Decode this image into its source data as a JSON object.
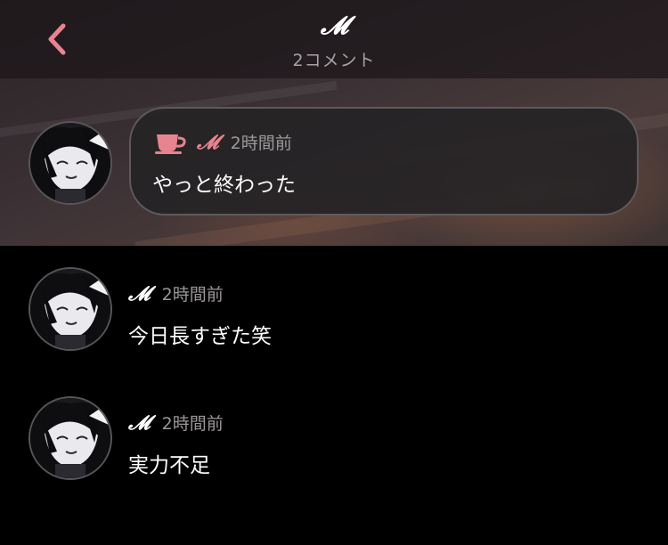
{
  "header": {
    "title": "𝓜",
    "subtitle": "2コメント",
    "back_icon": "chevron-left-icon",
    "accent_color": "#e8848f"
  },
  "comments": [
    {
      "author": "𝓜",
      "time": "2時間前",
      "text": "やっと終わった",
      "highlighted": true,
      "badge_icon": "coffee-cup-icon"
    },
    {
      "author": "𝓜",
      "time": "2時間前",
      "text": "今日長すぎた笑",
      "highlighted": false
    },
    {
      "author": "𝓜",
      "time": "2時間前",
      "text": "実力不足",
      "highlighted": false
    }
  ]
}
